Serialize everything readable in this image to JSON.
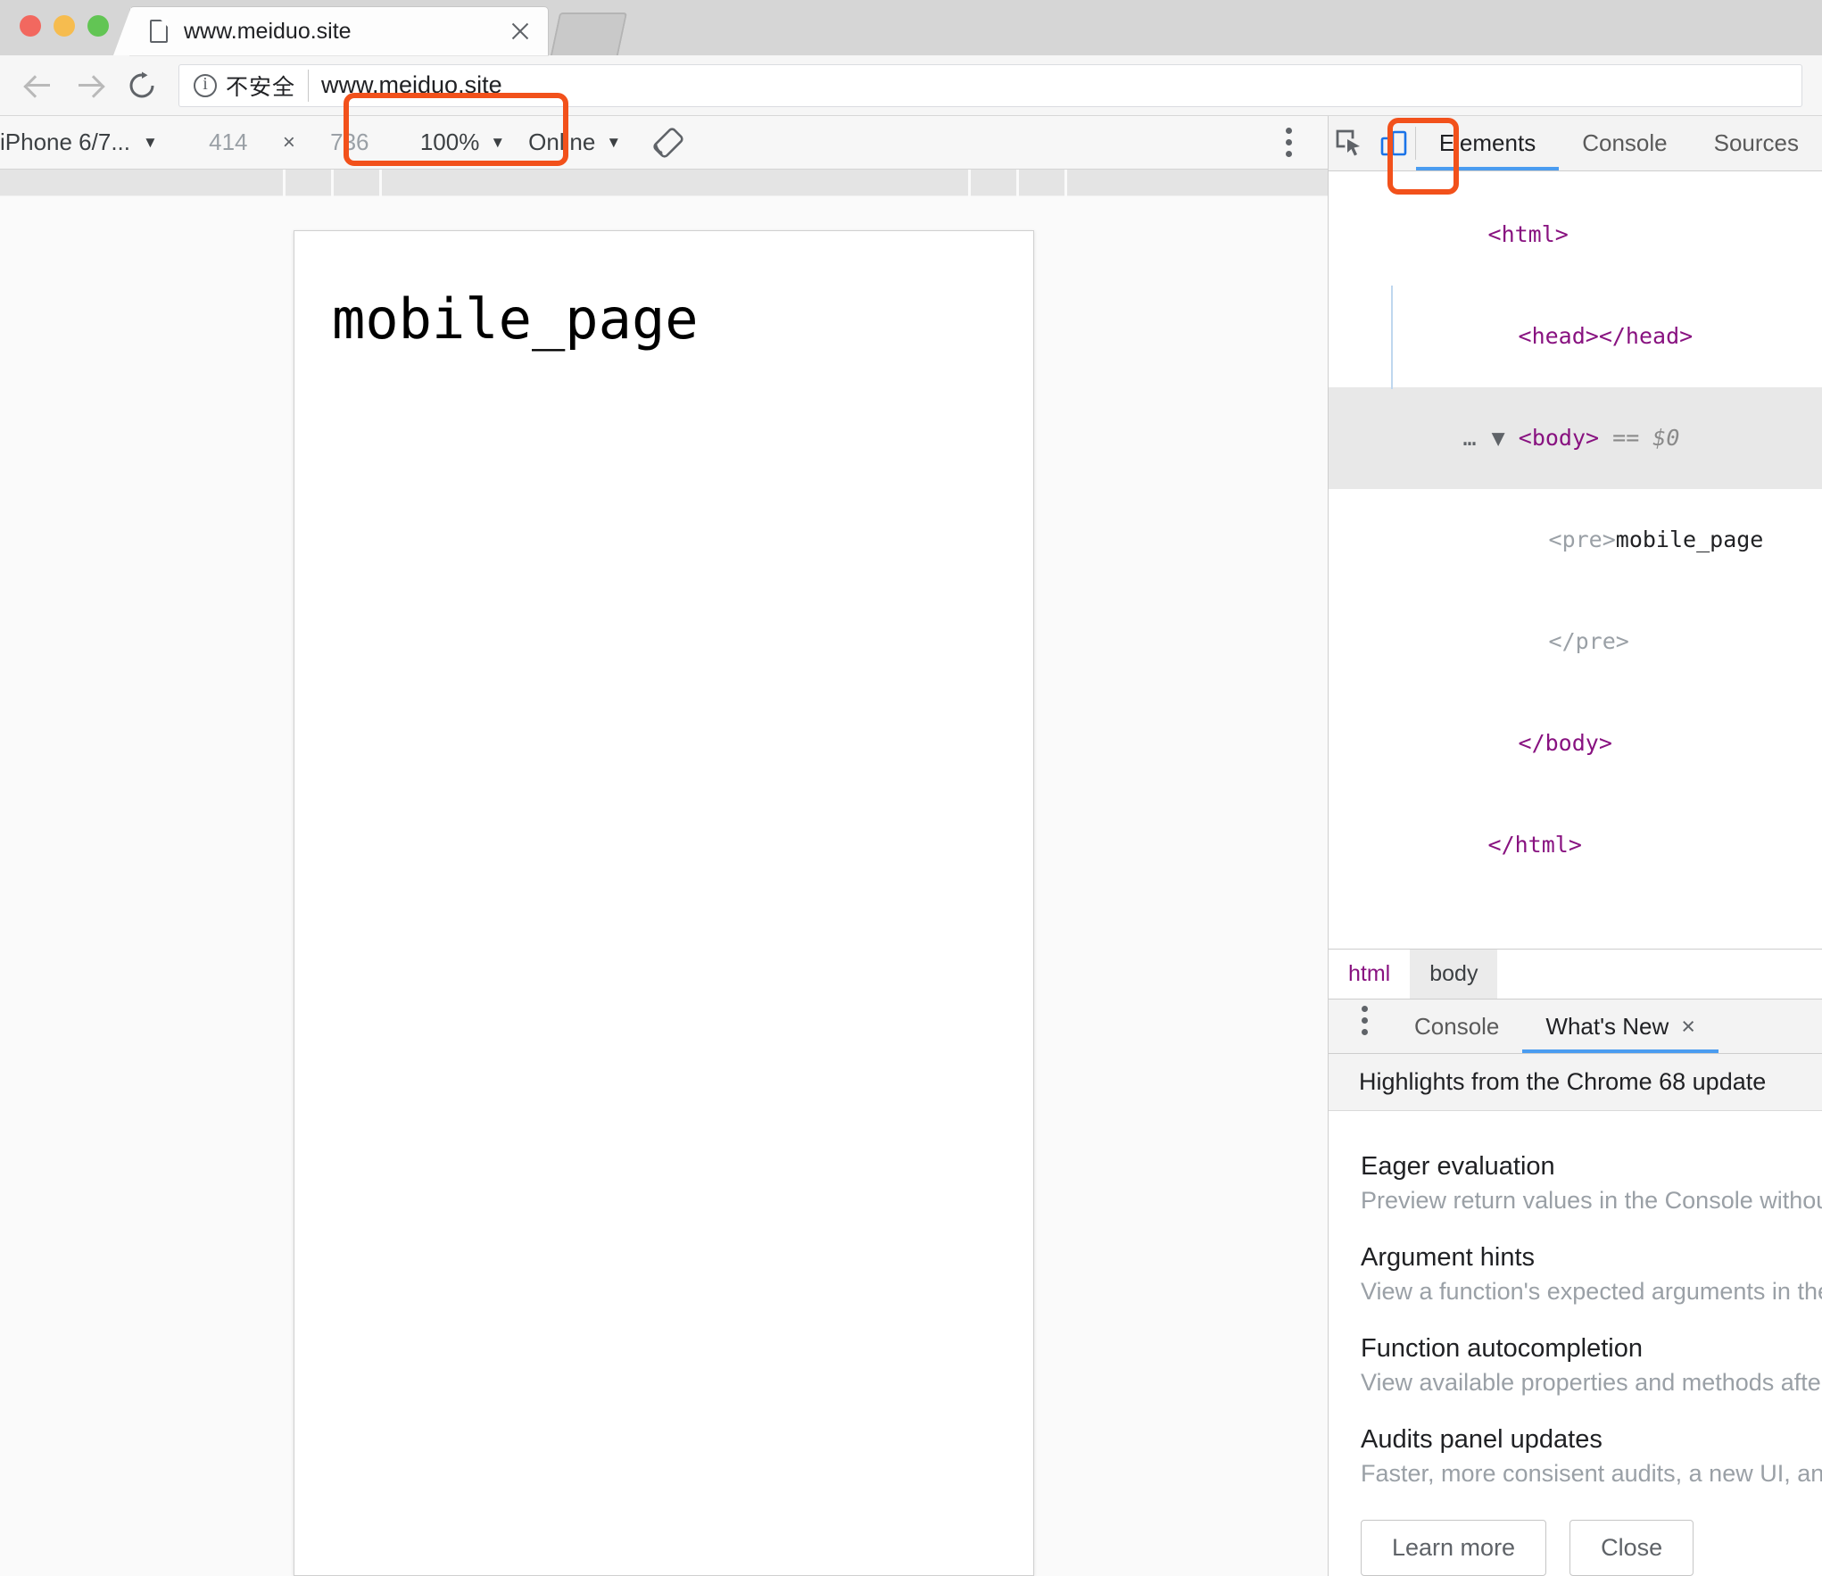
{
  "browser": {
    "tab": {
      "title": "www.meiduo.site",
      "favicon": "document-icon",
      "close": "close-icon"
    },
    "traffic_lights": [
      "close",
      "minimize",
      "zoom"
    ],
    "omnibox": {
      "back": "back-arrow-icon",
      "forward": "forward-arrow-icon",
      "reload": "reload-icon",
      "security_icon": "info-circle-icon",
      "security_label": "不安全",
      "url": "www.meiduo.site"
    }
  },
  "device_toolbar": {
    "device": "iPhone 6/7...",
    "width": "414",
    "height": "736",
    "times": "×",
    "zoom": "100%",
    "network": "Online",
    "rotate_icon": "rotate-device-icon",
    "menu_icon": "kebab-menu-icon",
    "caret": "▼"
  },
  "page": {
    "content": "mobile_page"
  },
  "devtools": {
    "icons": {
      "inspect": "inspect-element-icon",
      "device": "toggle-device-toolbar-icon"
    },
    "tabs": [
      {
        "label": "Elements",
        "active": true
      },
      {
        "label": "Console",
        "active": false
      },
      {
        "label": "Sources",
        "active": false
      }
    ],
    "dom": {
      "l1": "<html>",
      "l2": "<head></head>",
      "l3_prefix": "…",
      "l3_tri": "▼",
      "l3": "<body>",
      "l3_eq": "== $0",
      "l4": "<pre>",
      "l4_text": "mobile_page",
      "l5": "</pre>",
      "l6": "</body>",
      "l7": "</html>"
    },
    "breadcrumb": [
      {
        "label": "html",
        "selected": false
      },
      {
        "label": "body",
        "selected": true
      }
    ],
    "drawer": {
      "menu_icon": "kebab-menu-icon",
      "tabs": [
        {
          "label": "Console",
          "active": false,
          "closable": false
        },
        {
          "label": "What's New",
          "active": true,
          "closable": true,
          "close": "×"
        }
      ],
      "whats_new": {
        "header": "Highlights from the Chrome 68 update",
        "items": [
          {
            "title": "Eager evaluation",
            "desc": "Preview return values in the Console without"
          },
          {
            "title": "Argument hints",
            "desc": "View a function's expected arguments in the"
          },
          {
            "title": "Function autocompletion",
            "desc": "View available properties and methods after"
          },
          {
            "title": "Audits panel updates",
            "desc": "Faster, more consisent audits, a new UI, and"
          }
        ],
        "buttons": [
          {
            "label": "Learn more"
          },
          {
            "label": "Close"
          }
        ]
      }
    }
  },
  "annotations": {
    "accent_color": "#f2511b",
    "boxes": [
      "device-selector-highlight",
      "device-toolbar-button-highlight"
    ]
  }
}
